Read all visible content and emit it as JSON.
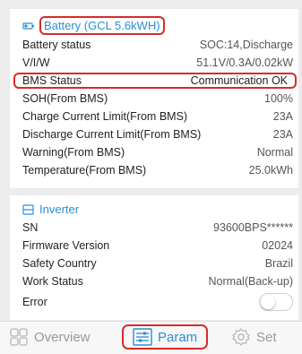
{
  "battery": {
    "title": "Battery (GCL 5.6kWH)",
    "rows": [
      {
        "label": "Battery status",
        "value": "SOC:14,Discharge"
      },
      {
        "label": "V/I/W",
        "value": "51.1V/0.3A/0.02kW"
      },
      {
        "label": "BMS Status",
        "value": "Communication OK"
      },
      {
        "label": "SOH(From BMS)",
        "value": "100%"
      },
      {
        "label": "Charge Current Limit(From BMS)",
        "value": "23A"
      },
      {
        "label": "Discharge Current Limit(From BMS)",
        "value": "23A"
      },
      {
        "label": "Warning(From BMS)",
        "value": "Normal"
      },
      {
        "label": "Temperature(From BMS)",
        "value": "25.0kWh"
      }
    ]
  },
  "inverter": {
    "title": "Inverter",
    "rows": [
      {
        "label": "SN",
        "value": "93600BPS******"
      },
      {
        "label": "Firmware Version",
        "value": "02024"
      },
      {
        "label": "Safety Country",
        "value": "Brazil"
      },
      {
        "label": "Work Status",
        "value": "Normal(Back-up)"
      },
      {
        "label": "Error",
        "value": ""
      }
    ],
    "error_toggle_on": false
  },
  "tabs": {
    "overview": "Overview",
    "param": "Param",
    "set": "Set",
    "active": "param"
  },
  "colors": {
    "accent": "#2a8fd6",
    "highlight": "#d62b2b"
  }
}
